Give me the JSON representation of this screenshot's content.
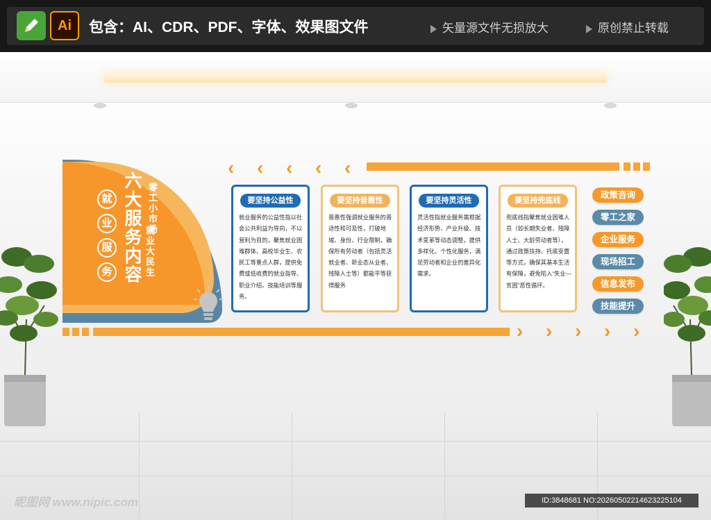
{
  "header": {
    "logo_label": "Ai",
    "includes_text": "包含：AI、CDR、PDF、字体、效果图文件",
    "notice_1": "矢量源文件无损放大",
    "notice_2": "原创禁止转载"
  },
  "wall": {
    "circles": [
      "就",
      "业",
      "服",
      "务"
    ],
    "main_title": "六大服务内容",
    "side_title_1": "零工小市场",
    "side_title_2": "就业大民生",
    "cards": [
      {
        "title": "要坚持公益性",
        "body": "就业服务的公益性指以社会公共利益为导向，不以营利为目的，聚焦就业困难群体、高校毕业生、农民工等重点人群，提供免费或低收费的就业指导、职业介绍、技能培训等服务。"
      },
      {
        "title": "要坚持普惠性",
        "body": "普惠性强调就业服务的普适性和可及性，打破地域、身份、行业限制，确保所有劳动者（包括灵活就业者、新业态从业者、残障人士等）都能平等获得服务"
      },
      {
        "title": "要坚持灵活性",
        "body": "灵活性指就业服务需根据经济形势、产业升级、技术变革等动态调整，提供多样化、个性化服务，满足劳动者和企业的差异化需求。"
      },
      {
        "title": "要坚持兜底线",
        "body": "兜底线指聚焦就业困难人员（如长期失业者、残障人士、大龄劳动者等），通过政策扶持、托底安置等方式，确保其基本生活有保障，避免陷入“失业—贫困”恶性循环。"
      }
    ],
    "tags": [
      {
        "label": "政策咨询",
        "color": "#f59a2a"
      },
      {
        "label": "零工之家",
        "color": "#5a8aa8"
      },
      {
        "label": "企业服务",
        "color": "#f59a2a"
      },
      {
        "label": "现场招工",
        "color": "#5a8aa8"
      },
      {
        "label": "信息发布",
        "color": "#f59a2a"
      },
      {
        "label": "技能提升",
        "color": "#5a8aa8"
      }
    ],
    "icon": "lightbulb-icon"
  },
  "footer": {
    "watermark": "昵图网 www.nipic.com",
    "id_text": "ID:3848681 NO:20260502214623225104"
  },
  "colors": {
    "accent_orange": "#f59a2a",
    "accent_blue": "#1f6bb4",
    "accent_steel": "#5a8aa8",
    "accent_gold": "#f2b45b"
  }
}
